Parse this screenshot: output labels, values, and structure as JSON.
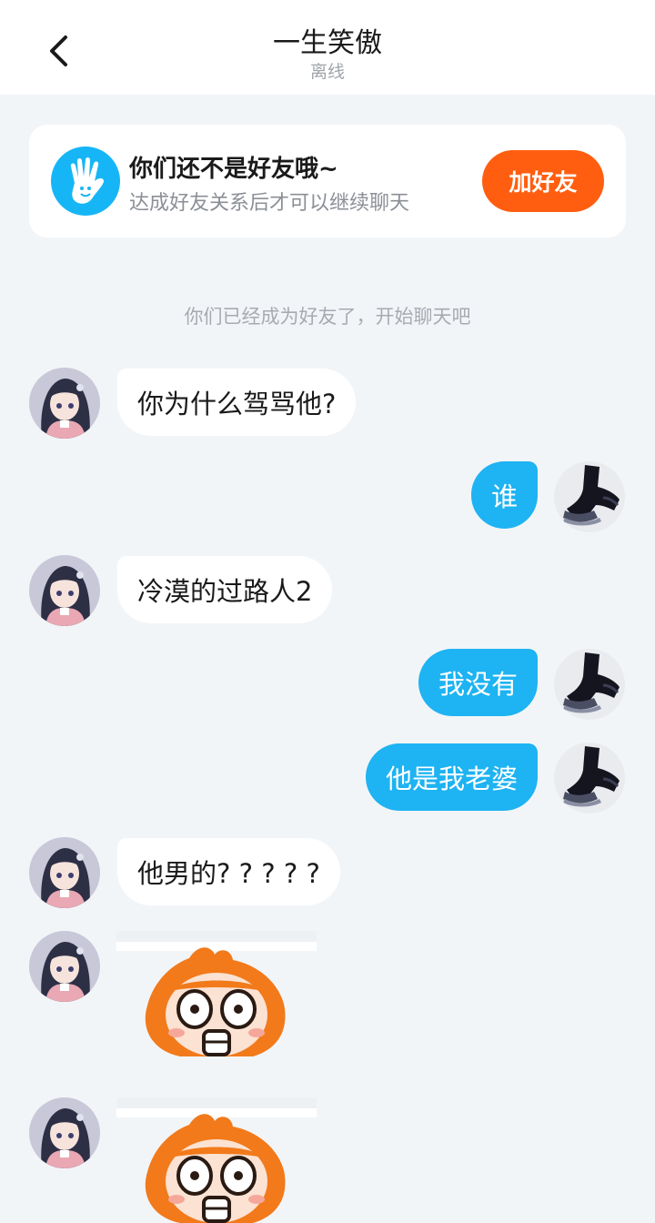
{
  "header": {
    "title": "一生笑傲",
    "status": "离线"
  },
  "friend_card": {
    "title": "你们还不是好友哦~",
    "description": "达成好友关系后才可以继续聊天",
    "add_button": "加好友"
  },
  "system_message": "你们已经成为好友了，开始聊天吧",
  "messages": [
    {
      "side": "left",
      "text": "你为什么驾骂他?"
    },
    {
      "side": "right",
      "text": "谁"
    },
    {
      "side": "left",
      "text": "冷漠的过路人2"
    },
    {
      "side": "right",
      "text": "我没有"
    },
    {
      "side": "right",
      "text": "他是我老婆"
    },
    {
      "side": "left",
      "text": "他男的? ? ? ? ?"
    },
    {
      "side": "left",
      "type": "sticker",
      "sticker": "shocked-orange-face-sticker"
    },
    {
      "side": "left",
      "type": "sticker",
      "sticker": "shocked-orange-face-sticker"
    }
  ],
  "colors": {
    "background": "#f2f5f8",
    "outgoing_bubble": "#1eb3f2",
    "incoming_bubble": "#ffffff",
    "add_button": "#ff5e10",
    "hand_icon_bg": "#16b6f6"
  }
}
